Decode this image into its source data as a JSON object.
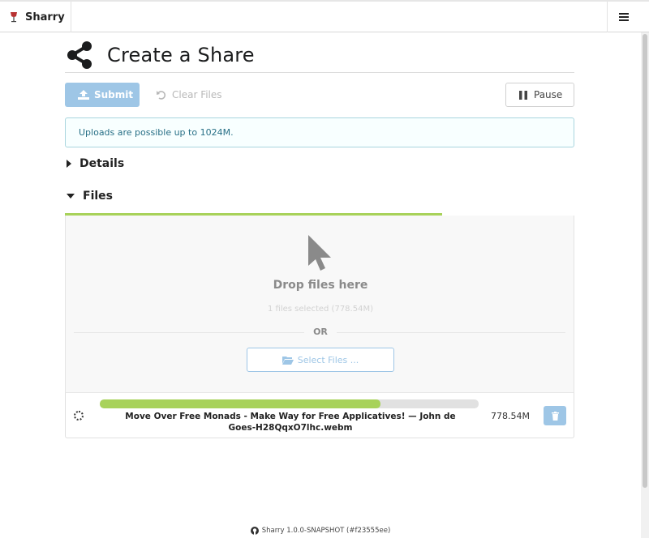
{
  "app": {
    "brand": "Sharry",
    "footer_version": "Sharry 1.0.0-SNAPSHOT (#f23555ee)"
  },
  "icons": {
    "brand": "wine-glass-icon",
    "menu": "hamburger-icon",
    "share": "share-icon",
    "submit": "upload-icon",
    "clear": "undo-icon",
    "pause": "pause-icon",
    "drop": "mouse-pointer-icon",
    "select": "folder-open-icon",
    "spinner": "spinner-icon",
    "delete": "trash-icon",
    "footer": "github-icon"
  },
  "colors": {
    "accent": "#9ec6e6",
    "progress": "#a8d25a",
    "info_text": "#276f86",
    "info_border": "#a9d5de"
  },
  "page": {
    "title": "Create a Share"
  },
  "toolbar": {
    "submit_label": "Submit",
    "clear_label": "Clear Files",
    "pause_label": "Pause"
  },
  "info": {
    "message": "Uploads are possible up to 1024M."
  },
  "sections": {
    "details": "Details",
    "files": "Files"
  },
  "dropzone": {
    "title": "Drop files here",
    "selected_summary": "1 files selected (778.54M)",
    "or_label": "OR",
    "select_label": "Select Files ..."
  },
  "overall_progress": 0.74,
  "files": [
    {
      "name": "Move Over Free Monads - Make Way for Free Applicatives! — John de Goes-H28QqxO7lhc.webm",
      "size": "778.54M",
      "progress": 0.74
    }
  ]
}
